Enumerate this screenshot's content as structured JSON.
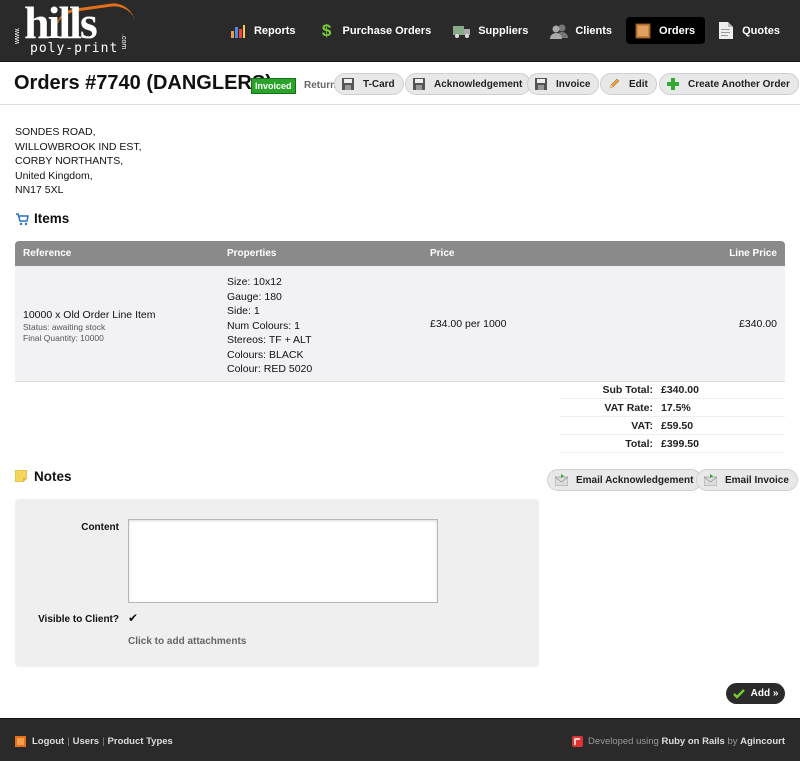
{
  "brand": {
    "www": "www.",
    "name": "hills",
    "sub": "poly-print",
    "com": ".com"
  },
  "nav": [
    {
      "label": "Reports",
      "icon": "bar-chart-icon"
    },
    {
      "label": "Purchase Orders",
      "icon": "dollar-icon"
    },
    {
      "label": "Suppliers",
      "icon": "truck-icon"
    },
    {
      "label": "Clients",
      "icon": "users-icon"
    },
    {
      "label": "Orders",
      "icon": "box-icon",
      "active": true
    },
    {
      "label": "Quotes",
      "icon": "document-icon"
    }
  ],
  "page": {
    "title": "Orders #7740 (DANGLERS)",
    "status_badge": "Invoiced",
    "return_link": "Return"
  },
  "actions": {
    "tcard": "T-Card",
    "acknowledgement": "Acknowledgement",
    "invoice": "Invoice",
    "edit": "Edit",
    "create_another": "Create Another Order"
  },
  "address": [
    "SONDES ROAD,",
    "WILLOWBROOK IND EST,",
    "CORBY NORTHANTS,",
    "United Kingdom,",
    "NN17 5XL"
  ],
  "items": {
    "heading": "Items",
    "columns": {
      "reference": "Reference",
      "properties": "Properties",
      "price": "Price",
      "line_price": "Line Price"
    },
    "rows": [
      {
        "reference": "10000 x Old Order Line Item",
        "status": "Status: awaiting stock",
        "final_quantity": "Final Quantity: 10000",
        "properties": [
          "Size: 10x12",
          "Gauge: 180",
          "Side: 1",
          "Num Colours: 1",
          "Stereos: TF + ALT",
          "Colours: BLACK",
          "Colour: RED 5020"
        ],
        "price": "£34.00 per 1000",
        "line_price": "£340.00"
      }
    ],
    "totals": [
      {
        "label": "Sub Total:",
        "value": "£340.00"
      },
      {
        "label": "VAT Rate:",
        "value": "17.5%"
      },
      {
        "label": "VAT:",
        "value": "£59.50"
      },
      {
        "label": "Total:",
        "value": "£399.50"
      }
    ]
  },
  "notes": {
    "heading": "Notes",
    "email_acknowledgement": "Email Acknowledgement",
    "email_invoice": "Email Invoice",
    "content_label": "Content",
    "content_value": "",
    "visible_label": "Visible to Client?",
    "visible_checked": true,
    "attachments_link": "Click to add attachments",
    "add_button": "Add »"
  },
  "footer": {
    "links": [
      "Logout",
      "Users",
      "Product Types"
    ],
    "credit_prefix": "Developed using",
    "credit_tech": "Ruby on Rails",
    "credit_by": "by",
    "credit_company": "Agincourt"
  },
  "colors": {
    "header_bg": "#2a2a2a",
    "accent_orange": "#e6701a",
    "badge_green": "#2aa32a",
    "table_head": "#8a8a8a"
  }
}
